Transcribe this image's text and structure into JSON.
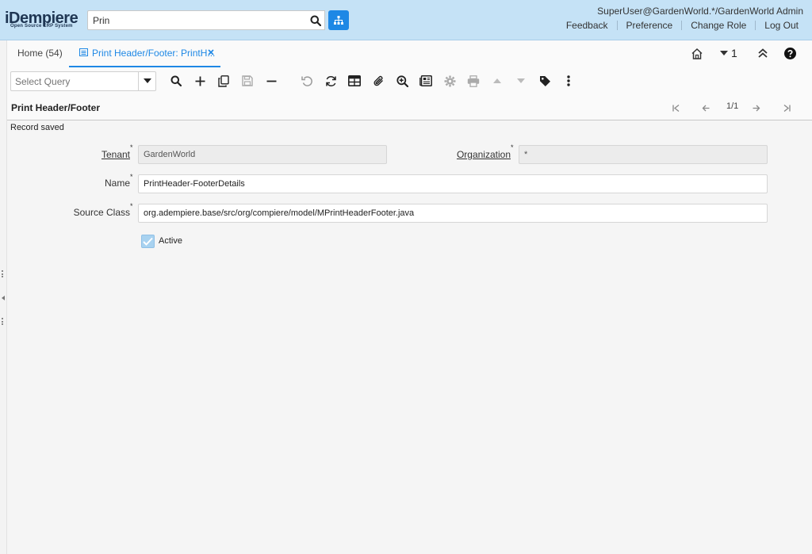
{
  "header": {
    "logo_text": "iDempiere",
    "logo_sub": "Open Source ERP System",
    "search_value": "Prin",
    "user": "SuperUser@GardenWorld.*/GardenWorld Admin",
    "links": [
      "Feedback",
      "Preference",
      "Change Role",
      "Log Out"
    ]
  },
  "tabs": {
    "home": "Home (54)",
    "active": "Print Header/Footer: PrintH...",
    "window_count": "1"
  },
  "toolbar": {
    "query_placeholder": "Select Query"
  },
  "window": {
    "title": "Print Header/Footer",
    "record_nav": "1/1",
    "status": "Record saved"
  },
  "form": {
    "tenant_label": "Tenant",
    "tenant_value": "GardenWorld",
    "org_label": "Organization",
    "org_value": "*",
    "name_label": "Name",
    "name_value": "PrintHeader-FooterDetails",
    "source_class_label": "Source Class",
    "source_class_value": "org.adempiere.base/src/org/compiere/model/MPrintHeaderFooter.java",
    "active_label": "Active",
    "active_checked": true,
    "required_mark": "*"
  },
  "colors": {
    "header_bg": "#c5e2f6",
    "accent": "#1e88e5"
  }
}
